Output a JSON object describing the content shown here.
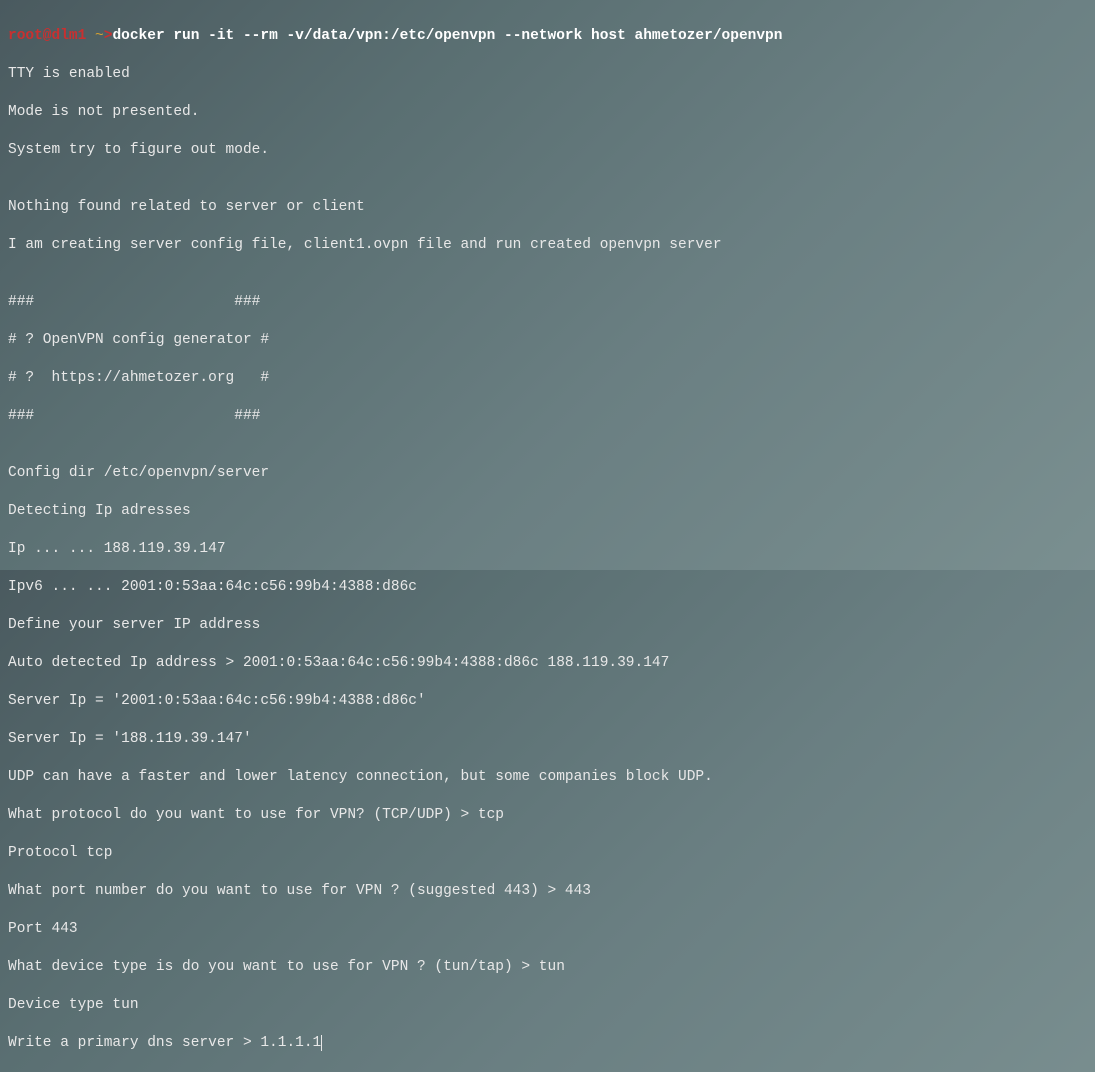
{
  "prompt": {
    "userhost": "root@dlm1",
    "cwd": "~",
    "arrow": ">"
  },
  "command": "docker run -it --rm -v/data/vpn:/etc/openvpn --network host ahmetozer/openvpn",
  "output": [
    "TTY is enabled",
    "Mode is not presented.",
    "System try to figure out mode.",
    "",
    "Nothing found related to server or client",
    "I am creating server config file, client1.ovpn file and run created openvpn server",
    "",
    "###                       ###",
    "# ? OpenVPN config generator #",
    "# ?  https://ahmetozer.org   #",
    "###                       ###",
    "",
    "Config dir /etc/openvpn/server",
    "Detecting Ip adresses",
    "Ip ... ... 188.119.39.147",
    "Ipv6 ... ... 2001:0:53aa:64c:c56:99b4:4388:d86c",
    "Define your server IP address",
    "Auto detected Ip address > 2001:0:53aa:64c:c56:99b4:4388:d86c 188.119.39.147",
    "Server Ip = '2001:0:53aa:64c:c56:99b4:4388:d86c'",
    "Server Ip = '188.119.39.147'",
    "UDP can have a faster and lower latency connection, but some companies block UDP.",
    "What protocol do you want to use for VPN? (TCP/UDP) > tcp",
    "Protocol tcp",
    "What port number do you want to use for VPN ? (suggested 443) > 443",
    "Port 443",
    "What device type is do you want to use for VPN ? (tun/tap) > tun",
    "Device type tun",
    "Write a primary dns server > 1.1.1.1"
  ]
}
